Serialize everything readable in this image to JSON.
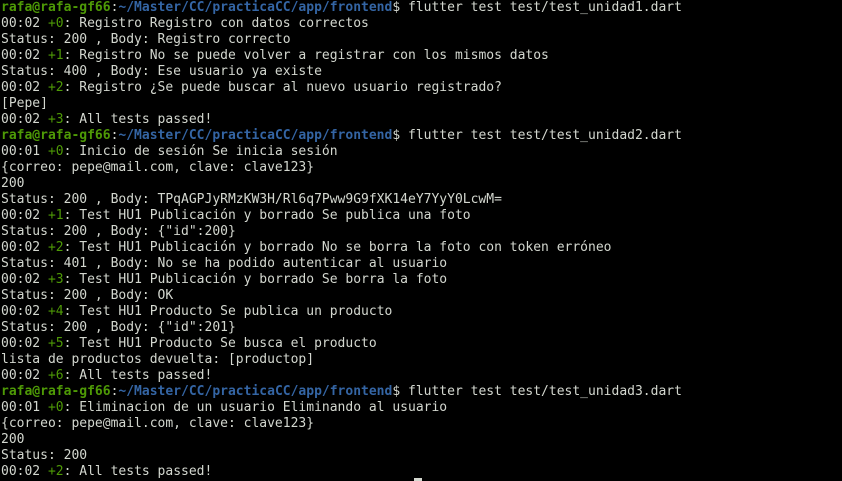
{
  "colors": {
    "background": "#000000",
    "text": "#d3d7cf",
    "prompt_user": "#4e9a06",
    "prompt_path": "#3465a4",
    "test_counter": "#4e9a06"
  },
  "lines": [
    {
      "kind": "prompt",
      "user": "rafa@rafa-gf66",
      "sep": ":",
      "path": "~/Master/CC/practicaCC/app/frontend",
      "suffix": "$ ",
      "cmd": "flutter test test/test_unidad1.dart"
    },
    {
      "kind": "test",
      "time": "00:02",
      "counter": "+0",
      "text": ": Registro Registro con datos correctos"
    },
    {
      "kind": "out",
      "text": "Status: 200 , Body: Registro correcto"
    },
    {
      "kind": "test",
      "time": "00:02",
      "counter": "+1",
      "text": ": Registro No se puede volver a registrar con los mismos datos"
    },
    {
      "kind": "out",
      "text": "Status: 400 , Body: Ese usuario ya existe"
    },
    {
      "kind": "test",
      "time": "00:02",
      "counter": "+2",
      "text": ": Registro ¿Se puede buscar al nuevo usuario registrado?"
    },
    {
      "kind": "out",
      "text": "[Pepe]"
    },
    {
      "kind": "test",
      "time": "00:02",
      "counter": "+3",
      "text": ": All tests passed!"
    },
    {
      "kind": "prompt",
      "user": "rafa@rafa-gf66",
      "sep": ":",
      "path": "~/Master/CC/practicaCC/app/frontend",
      "suffix": "$ ",
      "cmd": "flutter test test/test_unidad2.dart"
    },
    {
      "kind": "test",
      "time": "00:01",
      "counter": "+0",
      "text": ": Inicio de sesión Se inicia sesión"
    },
    {
      "kind": "out",
      "text": "{correo: pepe@mail.com, clave: clave123}"
    },
    {
      "kind": "out",
      "text": "200"
    },
    {
      "kind": "out",
      "text": "Status: 200 , Body: TPqAGPJyRMzKW3H/Rl6q7Pww9G9fXK14eY7YyY0LcwM="
    },
    {
      "kind": "test",
      "time": "00:02",
      "counter": "+1",
      "text": ": Test HU1 Publicación y borrado Se publica una foto"
    },
    {
      "kind": "out",
      "text": "Status: 200 , Body: {\"id\":200}"
    },
    {
      "kind": "test",
      "time": "00:02",
      "counter": "+2",
      "text": ": Test HU1 Publicación y borrado No se borra la foto con token erróneo"
    },
    {
      "kind": "out",
      "text": "Status: 401 , Body: No se ha podido autenticar al usuario"
    },
    {
      "kind": "test",
      "time": "00:02",
      "counter": "+3",
      "text": ": Test HU1 Publicación y borrado Se borra la foto"
    },
    {
      "kind": "out",
      "text": "Status: 200 , Body: OK"
    },
    {
      "kind": "test",
      "time": "00:02",
      "counter": "+4",
      "text": ": Test HU1 Producto Se publica un producto"
    },
    {
      "kind": "out",
      "text": "Status: 200 , Body: {\"id\":201}"
    },
    {
      "kind": "test",
      "time": "00:02",
      "counter": "+5",
      "text": ": Test HU1 Producto Se busca el producto"
    },
    {
      "kind": "out",
      "text": "lista de productos devuelta: [productop]"
    },
    {
      "kind": "test",
      "time": "00:02",
      "counter": "+6",
      "text": ": All tests passed!"
    },
    {
      "kind": "prompt",
      "user": "rafa@rafa-gf66",
      "sep": ":",
      "path": "~/Master/CC/practicaCC/app/frontend",
      "suffix": "$ ",
      "cmd": "flutter test test/test_unidad3.dart"
    },
    {
      "kind": "test",
      "time": "00:01",
      "counter": "+0",
      "text": ": Eliminacion de un usuario Eliminando al usuario"
    },
    {
      "kind": "out",
      "text": "{correo: pepe@mail.com, clave: clave123}"
    },
    {
      "kind": "out",
      "text": "200"
    },
    {
      "kind": "out",
      "text": "Status: 200"
    },
    {
      "kind": "test",
      "time": "00:02",
      "counter": "+2",
      "text": ": All tests passed!"
    }
  ]
}
